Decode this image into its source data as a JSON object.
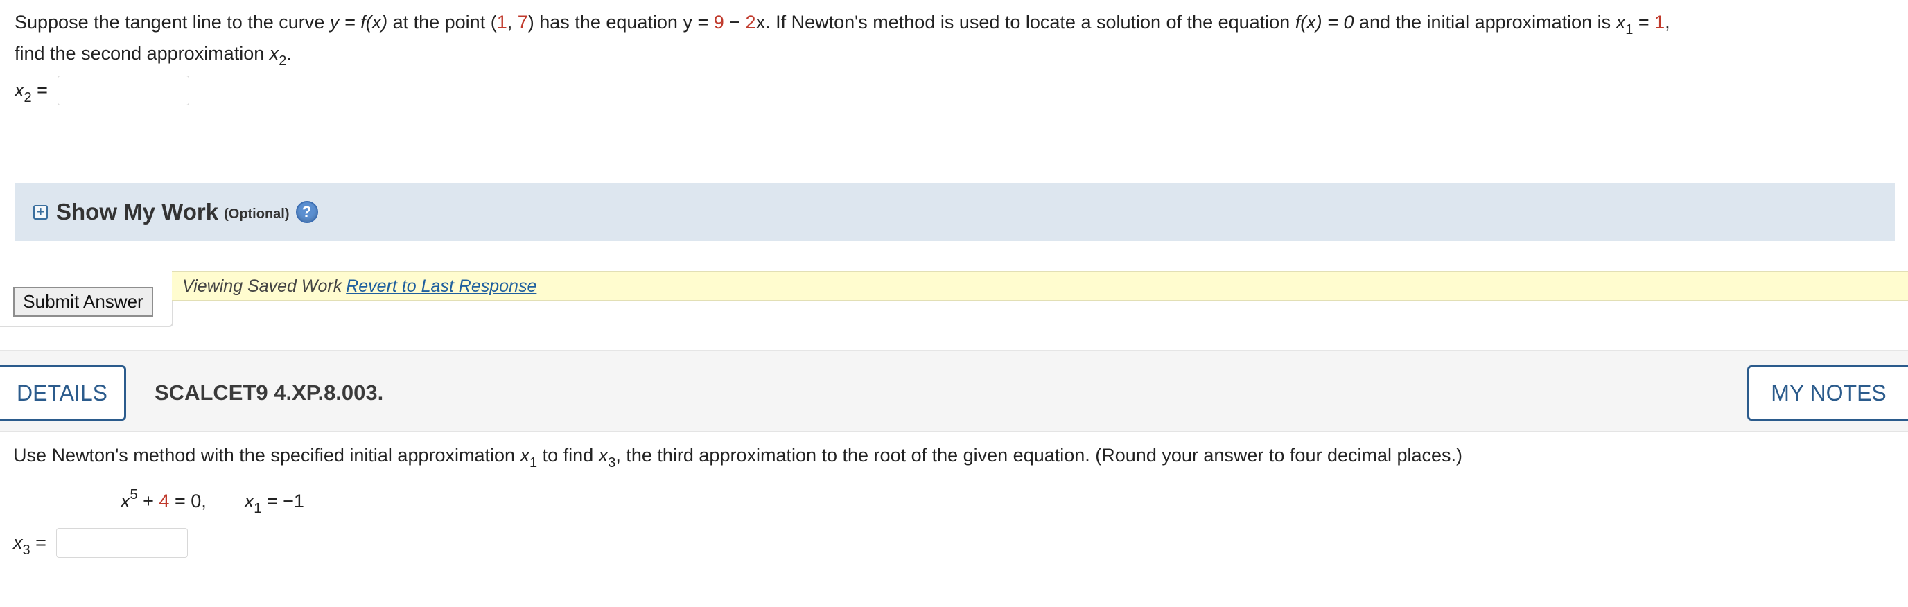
{
  "question1": {
    "text_a": "Suppose the tangent line to the curve ",
    "curve_eq": "y = f(x)",
    "text_b": " at the point (",
    "point_x": "1",
    "comma": ", ",
    "point_y": "7",
    "text_c": ") has the equation y = ",
    "tangent_const": "9",
    "minus": " − ",
    "tangent_coef": "2",
    "text_d": "x. If Newton's method is used to locate a solution of the equation ",
    "solve_eq": "f(x) = 0",
    "text_e": " and the initial approximation is ",
    "x1_var": "x",
    "x1_sub": "1",
    "x1_eq": " = ",
    "x1_val": "1",
    "text_f": ",",
    "text_g": "find the second approximation ",
    "x2_var": "x",
    "x2_sub": "2",
    "text_h": ".",
    "answer_var": "x",
    "answer_sub": "2",
    "answer_eq": " =",
    "answer_value": ""
  },
  "show_work": {
    "expand_glyph": "+",
    "title": "Show My Work",
    "optional": "(Optional)",
    "help_glyph": "?"
  },
  "submit": {
    "label": "Submit Answer"
  },
  "saved": {
    "text": "Viewing Saved Work",
    "revert_link": "Revert to Last Response"
  },
  "header": {
    "details_label": "DETAILS",
    "problem_id": "SCALCET9 4.XP.8.003.",
    "notes_label": "MY NOTES"
  },
  "question2": {
    "text_a": "Use Newton's method with the specified initial approximation ",
    "x1_var": "x",
    "x1_sub": "1",
    "text_b": " to find ",
    "x3_var": "x",
    "x3_sub": "3",
    "text_c": ", the third approximation to the root of the given equation. (Round your answer to four decimal places.)",
    "eq_base": "x",
    "eq_exp": "5",
    "eq_plus": " + ",
    "eq_const": "4",
    "eq_rest": " = 0,",
    "init_var": "x",
    "init_sub": "1",
    "init_eq": " = −1",
    "answer_var": "x",
    "answer_sub": "3",
    "answer_eq": " =",
    "answer_value": ""
  },
  "colors": {
    "accent_red": "#c0392b",
    "link_blue": "#1f5f9e",
    "work_bar_bg": "#dde6ef",
    "saved_bar_bg": "#fffccf",
    "header_button": "#2b5b8c"
  }
}
